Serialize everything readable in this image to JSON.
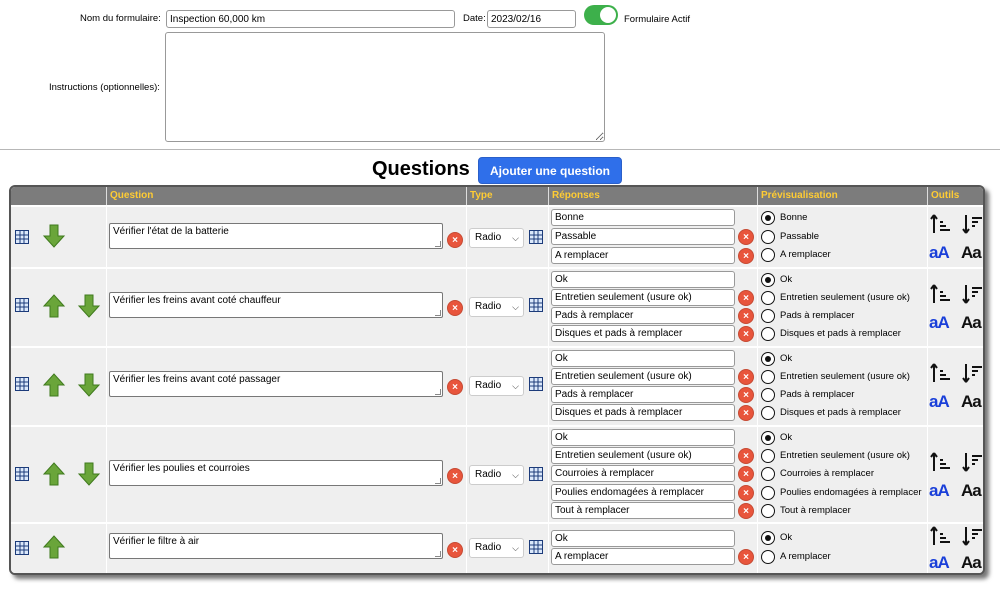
{
  "form": {
    "name_label": "Nom du formulaire:",
    "name_value": "Inspection 60,000 km",
    "date_label": "Date:",
    "date_value": "2023/02/16",
    "active_label": "Formulaire Actif",
    "active": true,
    "instructions_label": "Instructions (optionnelles):",
    "instructions_value": ""
  },
  "questions_section": {
    "title": "Questions",
    "add_button": "Ajouter une question",
    "headers": [
      "Question",
      "Type",
      "Réponses",
      "Prévisualisation",
      "Outils"
    ]
  },
  "colors": {
    "header_text": "#ffcc33",
    "accent": "#2f6fea",
    "toggle": "#3db04b",
    "delete": "#e8553c"
  },
  "rows": [
    {
      "question": "Vérifier l'état de la batterie",
      "type": "Radio",
      "answers": [
        "Bonne",
        "Passable",
        "A remplacer"
      ]
    },
    {
      "question": "Vérifier les freins avant coté chauffeur",
      "type": "Radio",
      "answers": [
        "Ok",
        "Entretien seulement (usure ok)",
        "Pads à remplacer",
        "Disques et pads à remplacer"
      ]
    },
    {
      "question": "Vérifier les freins avant coté passager",
      "type": "Radio",
      "answers": [
        "Ok",
        "Entretien seulement (usure ok)",
        "Pads à remplacer",
        "Disques et pads à remplacer"
      ]
    },
    {
      "question": "Vérifier les poulies et courroies",
      "type": "Radio",
      "answers": [
        "Ok",
        "Entretien seulement (usure ok)",
        "Courroies à remplacer",
        "Poulies endomagées à remplacer",
        "Tout à remplacer"
      ]
    },
    {
      "question": "Vérifier le filtre à air",
      "type": "Radio",
      "answers": [
        "Ok",
        "A remplacer"
      ]
    }
  ],
  "tools": {
    "increase_font": "aA",
    "decrease_font": "Aa",
    "delete_glyph": "×"
  },
  "icons": [
    "table-edit-icon",
    "arrow-up-icon",
    "arrow-down-icon",
    "delete-icon",
    "sort-ascending-icon",
    "sort-descending-icon",
    "font-increase-icon",
    "font-decrease-icon",
    "chevron-down-icon"
  ]
}
